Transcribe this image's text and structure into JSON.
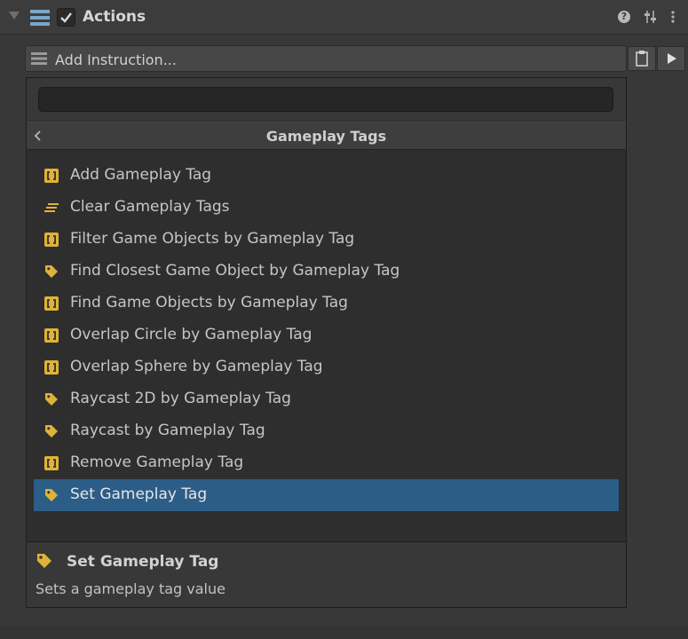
{
  "header": {
    "title": "Actions",
    "enabled": true,
    "icons": [
      "fold-triangle-icon",
      "list-icon",
      "checkbox-icon",
      "help-icon",
      "settings-sliders-icon",
      "more-icon"
    ]
  },
  "add_instruction": {
    "label": "Add Instruction...",
    "icons": [
      "list-icon",
      "clipboard-icon",
      "play-icon"
    ]
  },
  "dropdown": {
    "search": {
      "value": "",
      "placeholder": ""
    },
    "category": "Gameplay Tags",
    "items": [
      {
        "label": "Add Gameplay Tag",
        "icon": "bracket-icon",
        "selected": false
      },
      {
        "label": "Clear Gameplay Tags",
        "icon": "lines-icon",
        "selected": false
      },
      {
        "label": "Filter Game Objects by Gameplay Tag",
        "icon": "bracket-icon",
        "selected": false
      },
      {
        "label": "Find Closest Game Object by Gameplay Tag",
        "icon": "tag-icon",
        "selected": false
      },
      {
        "label": "Find Game Objects by Gameplay Tag",
        "icon": "bracket-icon",
        "selected": false
      },
      {
        "label": "Overlap Circle by Gameplay Tag",
        "icon": "bracket-icon",
        "selected": false
      },
      {
        "label": "Overlap Sphere by Gameplay Tag",
        "icon": "bracket-icon",
        "selected": false
      },
      {
        "label": "Raycast 2D by Gameplay Tag",
        "icon": "tag-icon",
        "selected": false
      },
      {
        "label": "Raycast by Gameplay Tag",
        "icon": "tag-icon",
        "selected": false
      },
      {
        "label": "Remove Gameplay Tag",
        "icon": "bracket-icon",
        "selected": false
      },
      {
        "label": "Set Gameplay Tag",
        "icon": "tag-icon",
        "selected": true
      }
    ]
  },
  "details": {
    "title": "Set Gameplay Tag",
    "description": "Sets a gameplay tag value",
    "icon": "tag-icon"
  },
  "colors": {
    "background": "#383838",
    "dropdown_bg": "#2e2e2e",
    "selection": "#2c5d87",
    "icon_yellow": "#e0b23a",
    "list_icon_blue": "#7aa6c8"
  }
}
